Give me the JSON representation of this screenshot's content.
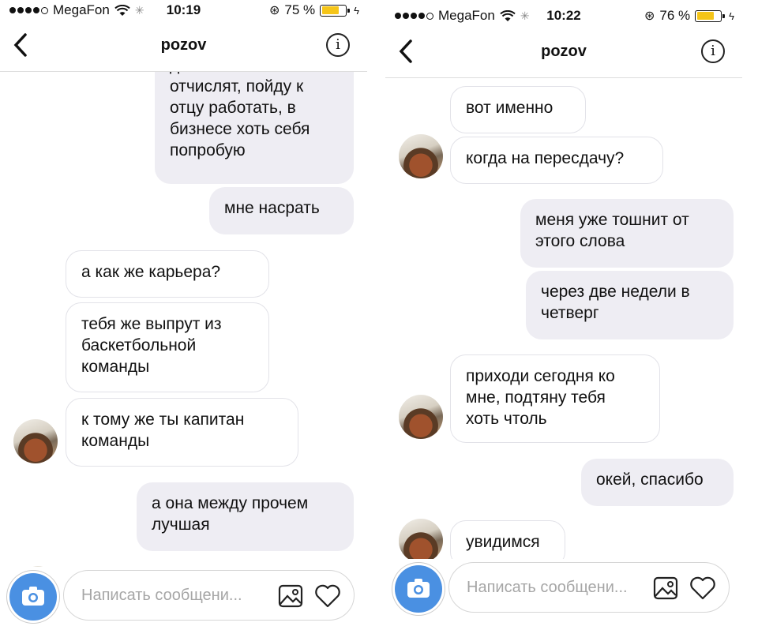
{
  "left": {
    "status": {
      "carrier": "MegaFon",
      "time": "10:19",
      "battery": "75 %",
      "battery_level": 0.75
    },
    "header": {
      "title": "pozov",
      "info": "i"
    },
    "messages": [
      {
        "dir": "out",
        "text": "даже если и\nотчислят, пойду к\nотцу работать, в\nбизнесе хоть себя\nпопробую"
      },
      {
        "dir": "out",
        "text": "мне насрать"
      },
      {
        "dir": "in",
        "text": "а как же карьера?"
      },
      {
        "dir": "in",
        "text": "тебя же выпрут из\nбаскетбольной\nкоманды"
      },
      {
        "dir": "in",
        "text": "к тому же ты капитан\nкоманды"
      },
      {
        "dir": "out",
        "text": "а она между прочем\nлучшая"
      }
    ],
    "composer": {
      "placeholder": "Написать сообщени..."
    }
  },
  "right": {
    "status": {
      "carrier": "MegaFon",
      "time": "10:22",
      "battery": "76 %",
      "battery_level": 0.76
    },
    "header": {
      "title": "pozov",
      "info": "i"
    },
    "messages": [
      {
        "dir": "in",
        "text": "вот именно"
      },
      {
        "dir": "in",
        "text": "когда на пересдачу?"
      },
      {
        "dir": "out",
        "text": "меня уже тошнит от\nэтого слова"
      },
      {
        "dir": "out",
        "text": "через две недели в\nчетверг"
      },
      {
        "dir": "in",
        "text": "приходи сегодня ко\nмне, подтяну тебя\nхоть чтоль"
      },
      {
        "dir": "out",
        "text": "окей, спасибо"
      },
      {
        "dir": "in",
        "text": "увидимся"
      }
    ],
    "composer": {
      "placeholder": "Написать сообщени..."
    }
  },
  "colors": {
    "accent": "#4a90e2",
    "bubble_out": "#eeedf3",
    "battery": "#f5c518"
  },
  "icons": [
    "chevron-left-icon",
    "info-icon",
    "camera-icon",
    "image-icon",
    "heart-icon",
    "wifi-icon",
    "signal-dots-icon",
    "lock-rotation-icon",
    "charging-icon"
  ]
}
